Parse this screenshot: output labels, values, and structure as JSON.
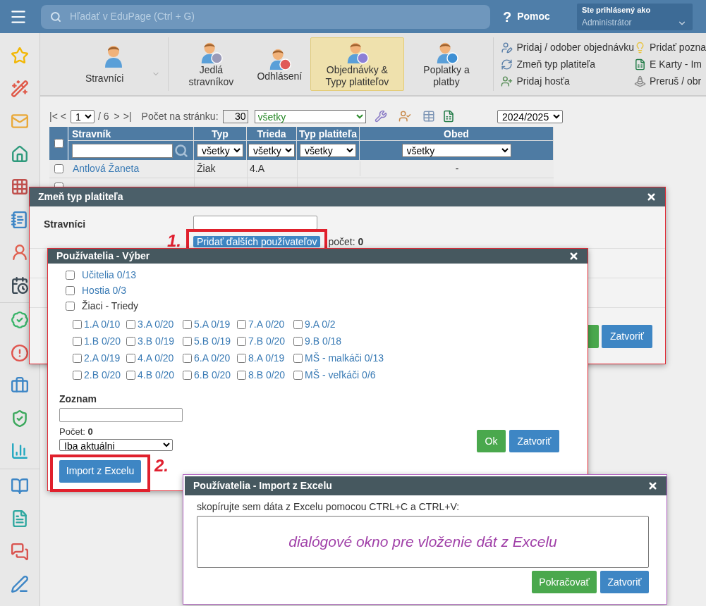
{
  "topbar": {
    "search_placeholder": "Hľadať v EduPage (Ctrl + G)",
    "help": {
      "icon": "?",
      "label": "Pomoc"
    },
    "user": {
      "caption": "Ste prihlásený ako",
      "name": "Administrátor"
    }
  },
  "ribbon": {
    "main": {
      "label": "Stravníci"
    },
    "items": [
      {
        "label": "Jedlá stravníkov",
        "selected": false
      },
      {
        "label": "Odhlásení",
        "selected": false
      },
      {
        "label": "Objednávky & Typy platiteľov",
        "selected": true
      },
      {
        "label": "Poplatky a platby",
        "selected": false
      }
    ],
    "actions": [
      [
        "Pridaj / odober objednávku",
        "Zmeň typ platiteľa",
        "Pridaj hosťa"
      ],
      [
        "Pridať pozna",
        "E Karty - Im",
        "Preruš / obr"
      ]
    ]
  },
  "toolbar": {
    "first": "|<",
    "prev": "<",
    "page": "1",
    "pages": "/ 6",
    "next": ">",
    "last": ">|",
    "per_page_label": "Počet na stránku:",
    "per_page": "30",
    "filter": "všetky",
    "year": "2024/2025"
  },
  "table": {
    "columns": [
      "Stravník",
      "Typ",
      "Trieda",
      "Typ platiteľa",
      "Obed"
    ],
    "filters": [
      "všetky",
      "všetky",
      "všetky",
      "všetky"
    ],
    "rows": [
      {
        "checked": false,
        "name": "Antlová Žaneta",
        "type": "Žiak",
        "class": "4.A",
        "lunch": "-"
      },
      {
        "checked": false
      }
    ],
    "all_checked": false
  },
  "dialog_payer": {
    "title": "Zmeň typ platiteľa",
    "field_label": "Stravníci",
    "step": "1.",
    "add_button": "Pridať ďalších používateľov",
    "count_label": "počet:",
    "count": "0",
    "close_button": "Zatvoriť"
  },
  "dialog_select": {
    "title": "Používatelia - Výber",
    "groups": [
      {
        "label": "Učitelia 0/13",
        "checked": false,
        "linked": true
      },
      {
        "label": "Hostia 0/3",
        "checked": false,
        "linked": true
      },
      {
        "label": "Žiaci - Triedy",
        "checked": false,
        "linked": false
      }
    ],
    "classes": [
      {
        "label": "1.A 0/10",
        "checked": false
      },
      {
        "label": "3.A 0/20",
        "checked": false
      },
      {
        "label": "5.A 0/19",
        "checked": false
      },
      {
        "label": "7.A 0/20",
        "checked": false
      },
      {
        "label": "9.A 0/2",
        "checked": false
      },
      {
        "label": "1.B 0/20",
        "checked": false
      },
      {
        "label": "3.B 0/19",
        "checked": false
      },
      {
        "label": "5.B 0/19",
        "checked": false
      },
      {
        "label": "7.B 0/20",
        "checked": false
      },
      {
        "label": "9.B 0/18",
        "checked": false
      },
      {
        "label": "2.A 0/19",
        "checked": false
      },
      {
        "label": "4.A 0/20",
        "checked": false
      },
      {
        "label": "6.A 0/20",
        "checked": false
      },
      {
        "label": "8.A 0/19",
        "checked": false
      },
      {
        "label": "MŠ - malkáči 0/13",
        "checked": false
      },
      {
        "label": "2.B 0/20",
        "checked": false
      },
      {
        "label": "4.B 0/20",
        "checked": false
      },
      {
        "label": "6.B 0/20",
        "checked": false
      },
      {
        "label": "8.B 0/20",
        "checked": false
      },
      {
        "label": "MŠ - veľkáči 0/6",
        "checked": false
      }
    ],
    "list_label": "Zoznam",
    "count_label": "Počet:",
    "count": "0",
    "scope": "Iba aktuálni",
    "import_button": "Import z Excelu",
    "step": "2.",
    "ok_button": "Ok",
    "close_button": "Zatvoriť"
  },
  "dialog_import": {
    "title": "Používatelia - Import z Excelu",
    "instruction": "skopírujte sem dáta z Excelu pomocou CTRL+C a CTRL+V:",
    "annotation": "dialógové okno pre vloženie dát z Excelu",
    "continue_button": "Pokračovať",
    "close_button": "Zatvoriť"
  }
}
